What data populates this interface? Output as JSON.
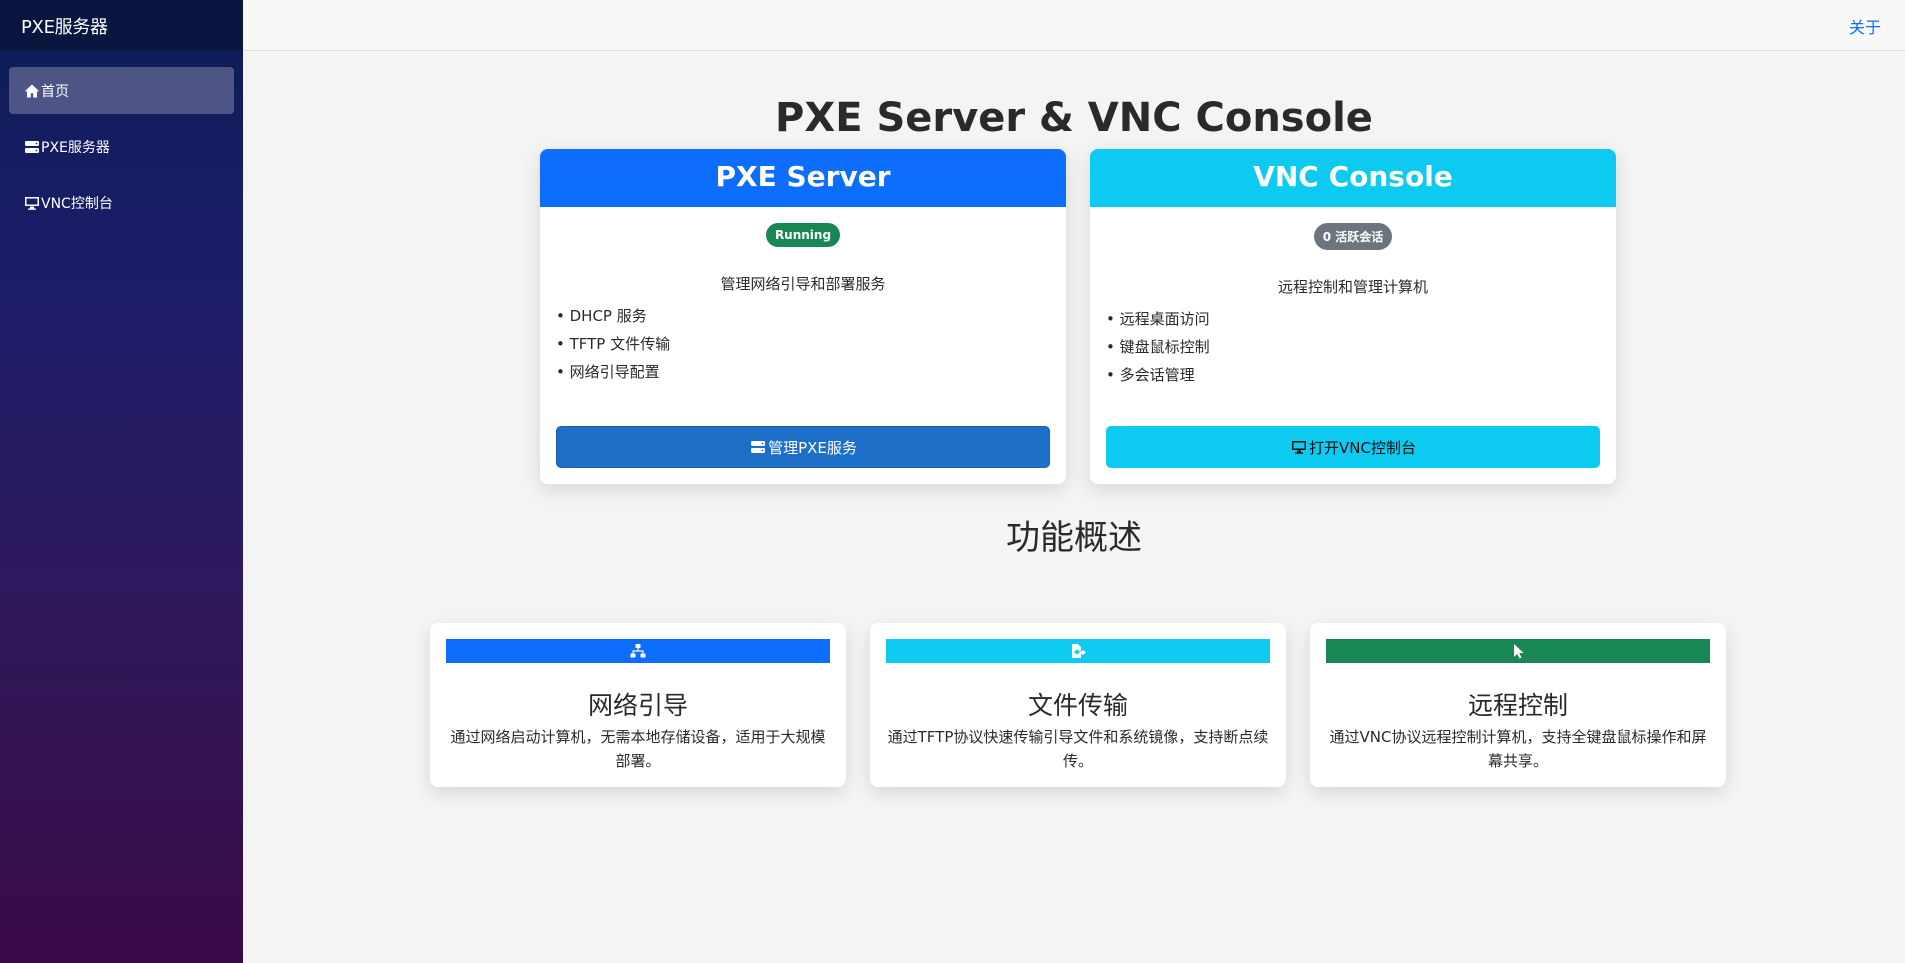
{
  "app": {
    "brand": "PXE服务器"
  },
  "sidebar": {
    "items": [
      {
        "label": "首页",
        "icon": "home-icon",
        "active": true
      },
      {
        "label": "PXE服务器",
        "icon": "server-icon",
        "active": false
      },
      {
        "label": "VNC控制台",
        "icon": "desktop-icon",
        "active": false
      }
    ]
  },
  "topbar": {
    "about": "关于"
  },
  "main": {
    "title": "PXE Server & VNC Console",
    "pxe_card": {
      "title": "PXE Server",
      "status": "Running",
      "status_color": "#198754",
      "description": "管理网络引导和部署服务",
      "features": [
        "• DHCP 服务",
        "• TFTP 文件传输",
        "• 网络引导配置"
      ],
      "button": "管理PXE服务"
    },
    "vnc_card": {
      "title": "VNC Console",
      "status": "0 活跃会话",
      "status_color": "#6c757d",
      "description": "远程控制和管理计算机",
      "features": [
        "• 远程桌面访问",
        "• 键盘鼠标控制",
        "• 多会话管理"
      ],
      "button": "打开VNC控制台"
    },
    "overview_title": "功能概述",
    "features": [
      {
        "icon": "network-icon",
        "color": "#0d6efd",
        "title": "网络引导",
        "text": "通过网络启动计算机，无需本地存储设备，适用于大规模部署。"
      },
      {
        "icon": "file-transfer-icon",
        "color": "#0dcaf0",
        "title": "文件传输",
        "text": "通过TFTP协议快速传输引导文件和系统镜像，支持断点续传。"
      },
      {
        "icon": "pointer-icon",
        "color": "#198754",
        "title": "远程控制",
        "text": "通过VNC协议远程控制计算机，支持全键盘鼠标操作和屏幕共享。"
      }
    ]
  }
}
